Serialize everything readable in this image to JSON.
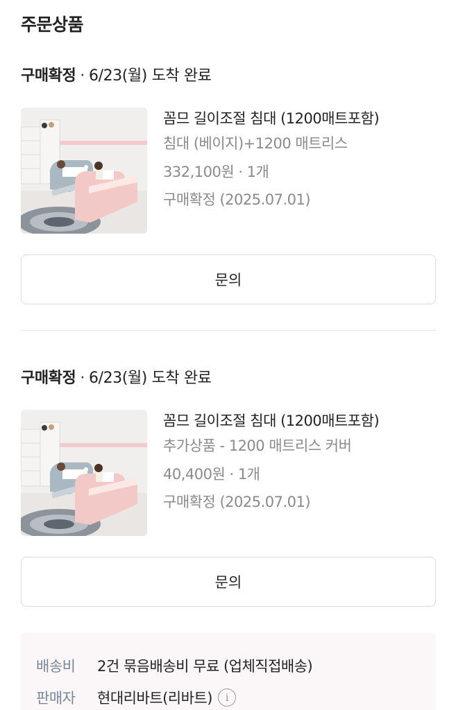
{
  "section": {
    "title": "주문상품"
  },
  "orders": [
    {
      "status": "구매확정",
      "separator": "·",
      "arrival": "6/23(월) 도착 완료",
      "product": {
        "name": "꼼므 길이조절 침대 (1200매트포함)",
        "option": "침대 (베이지)+1200 매트리스",
        "price_qty": "332,100원 · 1개",
        "confirm": "구매확정 (2025.07.01)"
      },
      "inquiry_label": "문의"
    },
    {
      "status": "구매확정",
      "separator": "·",
      "arrival": "6/23(월) 도착 완료",
      "product": {
        "name": "꼼므 길이조절 침대 (1200매트포함)",
        "option": "추가상품 - 1200 매트리스 커버",
        "price_qty": "40,400원 · 1개",
        "confirm": "구매확정 (2025.07.01)"
      },
      "inquiry_label": "문의"
    }
  ],
  "shipping": {
    "fee_label": "배송비",
    "fee_value": "2건 묶음배송비 무료 (업체직접배송)",
    "seller_label": "판매자",
    "seller_value": "현대리바트(리바트)",
    "info_icon": "i"
  },
  "colors": {
    "muted_text": "#8a8a8a",
    "label_text": "#7a8796",
    "shipping_bg": "#fbf7f8",
    "button_border": "#dcdcdc"
  }
}
